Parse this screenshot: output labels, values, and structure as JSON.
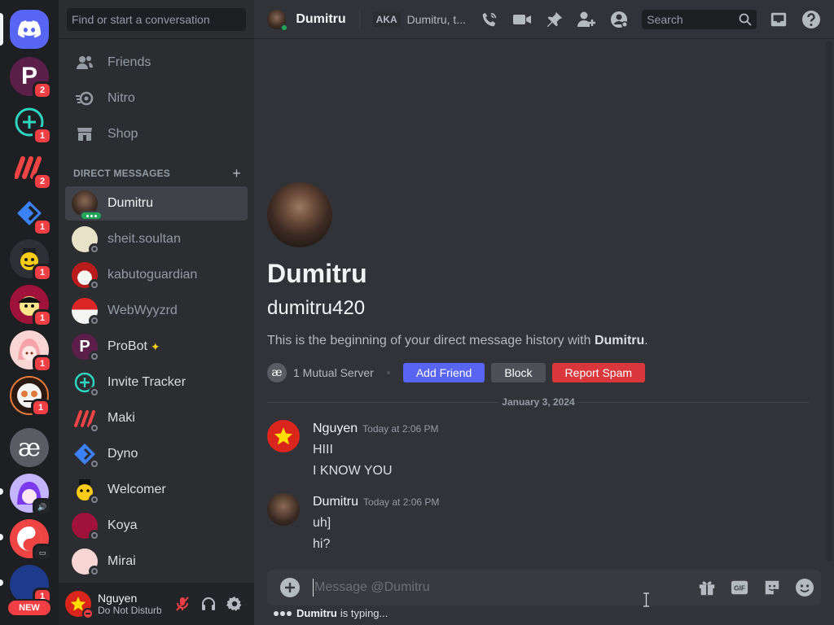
{
  "rail": {
    "home_label": "Direct Messages",
    "servers": [
      {
        "badge": "2"
      },
      {
        "badge": "1"
      },
      {
        "badge": "2"
      },
      {
        "badge": "1"
      },
      {
        "badge": "1"
      },
      {
        "badge": "1"
      },
      {
        "badge": "1"
      },
      {
        "badge": "1"
      },
      {
        "badge": ""
      },
      {
        "badge": ""
      },
      {
        "badge": ""
      },
      {
        "badge": "1"
      }
    ],
    "mutual_glyph": "æ",
    "new_label": "NEW"
  },
  "sidebar": {
    "search_placeholder": "Find or start a conversation",
    "nav": [
      {
        "label": "Friends",
        "icon": "friends-icon"
      },
      {
        "label": "Nitro",
        "icon": "nitro-icon"
      },
      {
        "label": "Shop",
        "icon": "shop-icon"
      }
    ],
    "dm_header": "DIRECT MESSAGES",
    "dms": [
      {
        "name": "Dumitru",
        "active": true
      },
      {
        "name": "sheit.soultan"
      },
      {
        "name": "kabutoguardian"
      },
      {
        "name": "WebWyyzrd"
      },
      {
        "name": "ProBot"
      },
      {
        "name": "Invite Tracker"
      },
      {
        "name": "Maki"
      },
      {
        "name": "Dyno"
      },
      {
        "name": "Welcomer"
      },
      {
        "name": "Koya"
      },
      {
        "name": "Mirai"
      }
    ]
  },
  "user_panel": {
    "name": "Nguyen",
    "status": "Do Not Disturb"
  },
  "topbar": {
    "name": "Dumitru",
    "aka_label": "AKA",
    "aka_value": "Dumitru, t...",
    "search_placeholder": "Search"
  },
  "welcome": {
    "name": "Dumitru",
    "handle": "dumitru420",
    "intro_prefix": "This is the beginning of your direct message history with ",
    "intro_name": "Dumitru",
    "intro_suffix": ".",
    "mutual_label": "1 Mutual Server",
    "add_friend": "Add Friend",
    "block": "Block",
    "report_spam": "Report Spam"
  },
  "date_divider": "January 3, 2024",
  "messages": [
    {
      "author": "Nguyen",
      "timestamp": "Today at 2:06 PM",
      "lines": [
        "HIII",
        "I KNOW YOU"
      ]
    },
    {
      "author": "Dumitru",
      "timestamp": "Today at 2:06 PM",
      "lines": [
        "uh]",
        "hi?"
      ]
    }
  ],
  "composer": {
    "placeholder": "Message @Dumitru"
  },
  "typing": {
    "name": "Dumitru",
    "suffix": "is typing..."
  },
  "colors": {
    "blurple": "#5865f2",
    "danger": "#da373c",
    "online": "#23a55a",
    "dnd": "#f23f43"
  }
}
